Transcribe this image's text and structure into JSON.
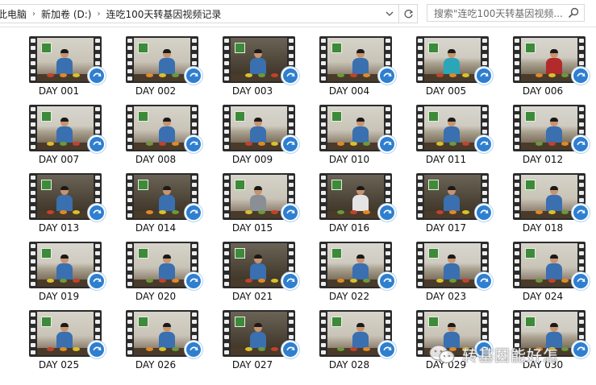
{
  "address_bar": {
    "crumbs": [
      "此电脑",
      "新加卷 (D:)",
      "连吃100天转基因视频记录"
    ],
    "search_placeholder": "搜索\"连吃100天转基因视频...",
    "dropdown_icon": "chevron-down-icon",
    "refresh_icon": "refresh-icon",
    "search_icon": "search-icon"
  },
  "files": [
    {
      "label": "DAY 001"
    },
    {
      "label": "DAY 002"
    },
    {
      "label": "DAY 003"
    },
    {
      "label": "DAY 004"
    },
    {
      "label": "DAY 005"
    },
    {
      "label": "DAY 006"
    },
    {
      "label": "DAY 007"
    },
    {
      "label": "DAY 008"
    },
    {
      "label": "DAY 009"
    },
    {
      "label": "DAY 010"
    },
    {
      "label": "DAY 011"
    },
    {
      "label": "DAY 012"
    },
    {
      "label": "DAY 013"
    },
    {
      "label": "DAY 014"
    },
    {
      "label": "DAY 015"
    },
    {
      "label": "DAY 016"
    },
    {
      "label": "DAY 017"
    },
    {
      "label": "DAY 018"
    },
    {
      "label": "DAY 019"
    },
    {
      "label": "DAY 020"
    },
    {
      "label": "DAY 021"
    },
    {
      "label": "DAY 022"
    },
    {
      "label": "DAY 023"
    },
    {
      "label": "DAY 024"
    },
    {
      "label": "DAY 025"
    },
    {
      "label": "DAY 026"
    },
    {
      "label": "DAY 027"
    },
    {
      "label": "DAY 028"
    },
    {
      "label": "DAY 029"
    },
    {
      "label": "DAY 030"
    }
  ],
  "watermark": {
    "text": "转基因能好怎",
    "icon": "wechat-icon"
  },
  "colors": {
    "play_badge": "#2f7fd0",
    "accent": "#3d8a3a"
  }
}
